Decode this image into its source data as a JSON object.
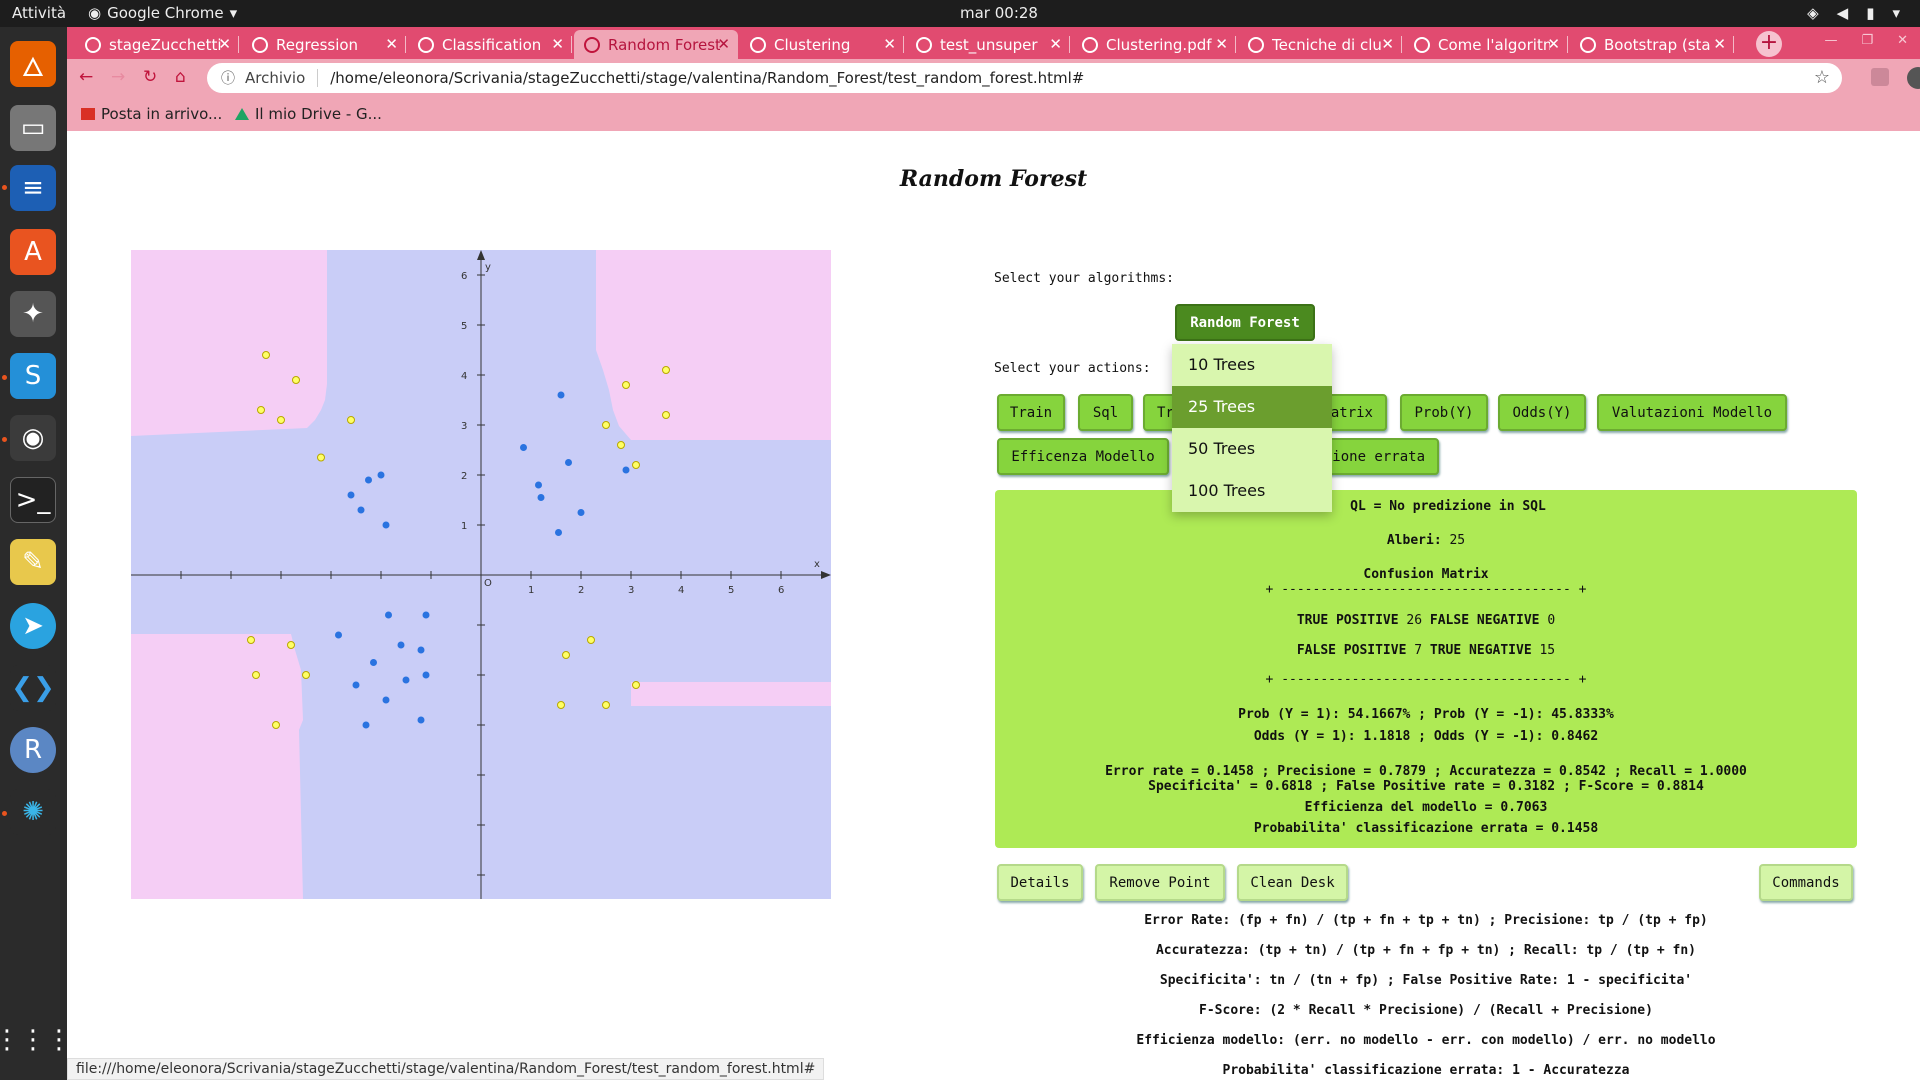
{
  "system": {
    "activities": "Attività",
    "app_name": "Google Chrome",
    "clock": "mar 00:28"
  },
  "browser": {
    "tabs": [
      {
        "label": "stageZucchetti",
        "active": false
      },
      {
        "label": "Regression",
        "active": false
      },
      {
        "label": "Classification",
        "active": false
      },
      {
        "label": "Random Forest",
        "active": true
      },
      {
        "label": "Clustering",
        "active": false
      },
      {
        "label": "test_unsuper",
        "active": false
      },
      {
        "label": "Clustering.pdf",
        "active": false
      },
      {
        "label": "Tecniche di clu",
        "active": false
      },
      {
        "label": "Come l'algoritm",
        "active": false
      },
      {
        "label": "Bootstrap (sta",
        "active": false
      }
    ],
    "address_prefix": "Archivio",
    "url": "/home/eleonora/Scrivania/stageZucchetti/stage/valentina/Random_Forest/test_random_forest.html#",
    "bookmarks": [
      "Posta in arrivo...",
      "Il mio Drive - G..."
    ],
    "status_url": "file:///home/eleonora/Scrivania/stageZucchetti/stage/valentina/Random_Forest/test_random_forest.html#"
  },
  "page": {
    "title": "Random Forest",
    "select_algorithms": "Select your algorithms:",
    "select_actions": "Select your actions:",
    "algorithm_button": "Random Forest",
    "dropdown_options": [
      "10 Trees",
      "25 Trees",
      "50 Trees",
      "100 Trees"
    ],
    "dropdown_selected": "25 Trees",
    "actions_row1": [
      "Train",
      "Sql",
      "Tr",
      "atrix",
      "Prob(Y)",
      "Odds(Y)",
      "Valutazioni Modello"
    ],
    "actions_row2": [
      "Efficenza Modello",
      "ione errata"
    ],
    "bottom_buttons": {
      "details": "Details",
      "remove_point": "Remove Point",
      "clean_desk": "Clean Desk",
      "commands": "Commands"
    },
    "results": {
      "sql": "QL = No predizione in SQL",
      "trees_label": "Alberi:",
      "trees_value": "25",
      "cm_title": "Confusion Matrix",
      "cm_border": "+ ------------------------------------- +",
      "tp_label": "TRUE POSITIVE",
      "tp": "26",
      "fn_label": "FALSE NEGATIVE",
      "fn": "0",
      "fp_label": "FALSE POSITIVE",
      "fp": "7",
      "tn_label": "TRUE NEGATIVE",
      "tn": "15",
      "prob_line": "Prob (Y = 1): 54.1667% ; Prob (Y = -1): 45.8333%",
      "odds_line": "Odds (Y = 1): 1.1818 ; Odds (Y = -1): 0.8462",
      "metrics_line1": "Error rate = 0.1458 ; Precisione = 0.7879 ; Accuratezza = 0.8542 ; Recall = 1.0000",
      "metrics_line2": "Specificita' = 0.6818 ; False Positive rate = 0.3182 ; F-Score = 0.8814",
      "efficiency": "Efficienza del modello = 0.7063",
      "misclass": "Probabilita' classificazione errata = 0.1458"
    },
    "formulas": [
      "Error Rate: (fp + fn) / (tp + fn + tp + tn) ; Precisione: tp / (tp + fp)",
      "Accuratezza: (tp + tn) / (tp + fn + fp + tn) ; Recall: tp / (tp + fn)",
      "Specificita': tn / (tn + fp) ; False Positive Rate: 1 - specificita'",
      "F-Score: (2 * Recall * Precisione) / (Recall + Precisione)",
      "Efficienza modello: (err. no modello - err. con modello) / err. no modello",
      "Probabilita' classificazione errata: 1 - Accuratezza"
    ]
  },
  "plot": {
    "x_label": "x",
    "y_label": "y",
    "origin_label": "O",
    "x_ticks": [
      "1",
      "2",
      "3",
      "4",
      "5",
      "6"
    ],
    "y_ticks": [
      "1",
      "2",
      "3",
      "4",
      "5",
      "6"
    ],
    "colors": {
      "pink": "#f5cef5",
      "blue": "#c9cdf7",
      "yellow": "#ffff66",
      "blue_dot": "#2a73e0"
    },
    "yellow_points": [
      [
        -4.3,
        4.4
      ],
      [
        -3.7,
        3.9
      ],
      [
        -4.4,
        3.3
      ],
      [
        -4.0,
        3.1
      ],
      [
        -2.6,
        3.1
      ],
      [
        -3.2,
        2.35
      ],
      [
        2.9,
        3.8
      ],
      [
        3.7,
        4.1
      ],
      [
        3.7,
        3.2
      ],
      [
        2.5,
        3.0
      ],
      [
        2.8,
        2.6
      ],
      [
        3.1,
        2.2
      ],
      [
        -4.6,
        -1.3
      ],
      [
        -3.8,
        -1.4
      ],
      [
        -4.5,
        -2.0
      ],
      [
        -3.5,
        -2.0
      ],
      [
        -4.1,
        -3.0
      ],
      [
        1.7,
        -1.6
      ],
      [
        2.2,
        -1.3
      ],
      [
        3.1,
        -2.2
      ],
      [
        1.6,
        -2.6
      ],
      [
        2.5,
        -2.6
      ]
    ],
    "blue_points": [
      [
        1.6,
        3.6
      ],
      [
        0.85,
        2.55
      ],
      [
        1.75,
        2.25
      ],
      [
        1.15,
        1.8
      ],
      [
        1.2,
        1.55
      ],
      [
        2.9,
        2.1
      ],
      [
        2.0,
        1.25
      ],
      [
        1.55,
        0.85
      ],
      [
        -2.0,
        2.0
      ],
      [
        -2.25,
        1.9
      ],
      [
        -2.6,
        1.6
      ],
      [
        -2.4,
        1.3
      ],
      [
        -1.9,
        1.0
      ],
      [
        -1.85,
        -0.8
      ],
      [
        -1.1,
        -0.8
      ],
      [
        -2.85,
        -1.2
      ],
      [
        -1.6,
        -1.4
      ],
      [
        -1.2,
        -1.5
      ],
      [
        -2.15,
        -1.75
      ],
      [
        -1.5,
        -2.1
      ],
      [
        -1.1,
        -2.0
      ],
      [
        -2.5,
        -2.2
      ],
      [
        -1.9,
        -2.5
      ],
      [
        -2.3,
        -3.0
      ],
      [
        -1.2,
        -2.9
      ]
    ]
  }
}
